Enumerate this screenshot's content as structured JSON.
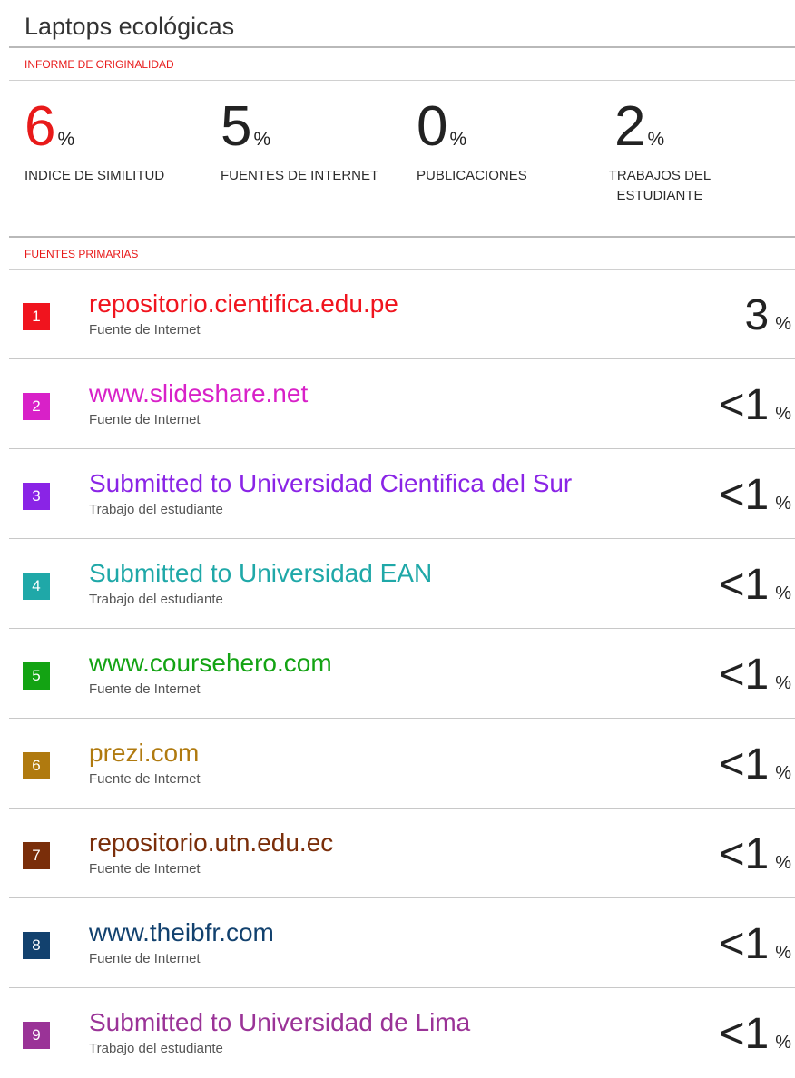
{
  "title": "Laptops ecológicas",
  "report_label": "INFORME DE ORIGINALIDAD",
  "stats": [
    {
      "value": "6",
      "unit": "%",
      "label": "INDICE DE SIMILITUD",
      "color": "#e81a1a"
    },
    {
      "value": "5",
      "unit": "%",
      "label": "FUENTES DE INTERNET",
      "color": "#222222"
    },
    {
      "value": "0",
      "unit": "%",
      "label": "PUBLICACIONES",
      "color": "#222222"
    },
    {
      "value": "2",
      "unit": "%",
      "label_line1": "TRABAJOS DEL",
      "label_line2": "ESTUDIANTE",
      "color": "#222222"
    }
  ],
  "sources_label": "FUENTES PRIMARIAS",
  "sources": [
    {
      "num": "1",
      "name": "repositorio.cientifica.edu.pe",
      "type": "Fuente de Internet",
      "value": "3",
      "unit": "%",
      "color": "#f0141e"
    },
    {
      "num": "2",
      "name": "www.slideshare.net",
      "type": "Fuente de Internet",
      "value": "<1",
      "unit": "%",
      "color": "#d821c8"
    },
    {
      "num": "3",
      "name": "Submitted to Universidad Cientifica del Sur",
      "type": "Trabajo del estudiante",
      "value": "<1",
      "unit": "%",
      "color": "#8a24e6"
    },
    {
      "num": "4",
      "name": "Submitted to Universidad EAN",
      "type": "Trabajo del estudiante",
      "value": "<1",
      "unit": "%",
      "color": "#1fa8a8"
    },
    {
      "num": "5",
      "name": "www.coursehero.com",
      "type": "Fuente de Internet",
      "value": "<1",
      "unit": "%",
      "color": "#13a313"
    },
    {
      "num": "6",
      "name": "prezi.com",
      "type": "Fuente de Internet",
      "value": "<1",
      "unit": "%",
      "color": "#b07a0f"
    },
    {
      "num": "7",
      "name": "repositorio.utn.edu.ec",
      "type": "Fuente de Internet",
      "value": "<1",
      "unit": "%",
      "color": "#7a2e0a"
    },
    {
      "num": "8",
      "name": "www.theibfr.com",
      "type": "Fuente de Internet",
      "value": "<1",
      "unit": "%",
      "color": "#12416e"
    },
    {
      "num": "9",
      "name": "Submitted to Universidad de Lima",
      "type": "Trabajo del estudiante",
      "value": "<1",
      "unit": "%",
      "color": "#9a3397"
    }
  ]
}
